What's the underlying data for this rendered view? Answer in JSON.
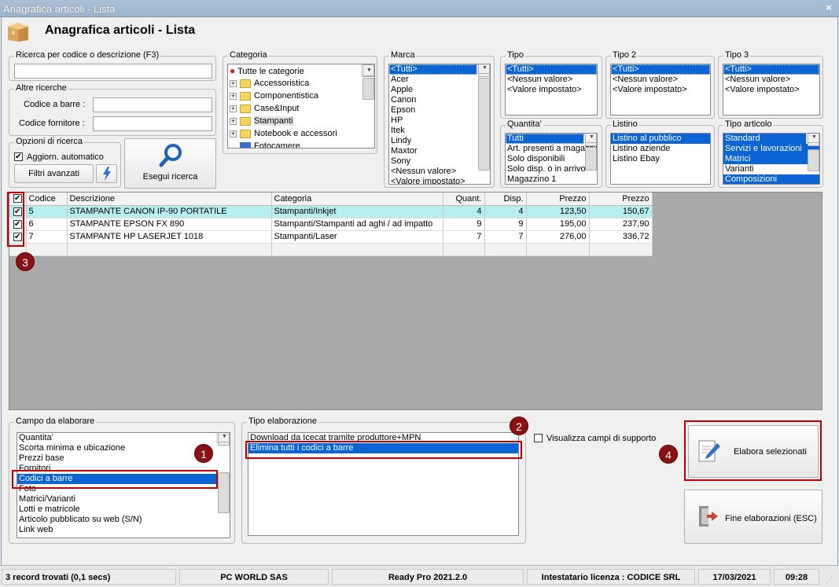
{
  "window": {
    "title": "Anagrafica articoli  - Lista",
    "close": "×"
  },
  "page_title": "Anagrafica articoli  - Lista",
  "search": {
    "label": "Ricerca per codice o descrizione (F3)",
    "value": ""
  },
  "altre": {
    "label": "Altre ricerche",
    "barcode_label": "Codice a barre :",
    "supplier_label": "Codice fornitore :"
  },
  "opzioni": {
    "label": "Opzioni di ricerca",
    "auto_label": "Aggiorn. automatico",
    "filtri": "Filtri avanzati",
    "esegui": "Esegui ricerca"
  },
  "categoria": {
    "label": "Categoria",
    "items": [
      "Tutte le categorie",
      "Accessoristica",
      "Componentistica",
      "Case&Input",
      "Stampanti",
      "Notebook e accessori",
      "Fotocamere"
    ]
  },
  "marca": {
    "label": "Marca",
    "items": [
      "<Tutti>",
      "Acer",
      "Apple",
      "Canon",
      "Epson",
      "HP",
      "Itek",
      "Lindy",
      "Maxtor",
      "Sony",
      "<Nessun valore>",
      "<Valore impostato>"
    ]
  },
  "tipo": {
    "label": "Tipo",
    "items": [
      "<Tutti>",
      "<Nessun valore>",
      "<Valore impostato>"
    ]
  },
  "tipo2": {
    "label": "Tipo 2",
    "items": [
      "<Tutti>",
      "<Nessun valore>",
      "<Valore impostato>"
    ]
  },
  "tipo3": {
    "label": "Tipo 3",
    "items": [
      "<Tutti>",
      "<Nessun valore>",
      "<Valore impostato>"
    ]
  },
  "quantita": {
    "label": "Quantita'",
    "items": [
      "Tutti",
      "Art. presenti a magazzino",
      "Solo disponibili",
      "Solo disp. o in arrivo",
      "Magazzino 1"
    ]
  },
  "listino": {
    "label": "Listino",
    "items": [
      "Listino al pubblico",
      "Listino aziende",
      "Listino Ebay"
    ]
  },
  "tipo_articolo": {
    "label": "Tipo articolo",
    "items": [
      "Standard",
      "Servizi e lavorazioni",
      "Matrici",
      "Varianti",
      "Composizioni"
    ]
  },
  "grid": {
    "headers": [
      "Codice",
      "Descrizione",
      "Categoria",
      "Quant.",
      "Disp.",
      "Prezzo",
      "Prezzo"
    ],
    "rows": [
      [
        "5",
        "STAMPANTE CANON IP-90 PORTATILE",
        "Stampanti/Inkjet",
        "4",
        "4",
        "123,50",
        "150,67"
      ],
      [
        "6",
        "STAMPANTE EPSON FX 890",
        "Stampanti/Stampanti ad aghi / ad impatto",
        "9",
        "9",
        "195,00",
        "237,90"
      ],
      [
        "7",
        "STAMPANTE HP LASERJET 1018",
        "Stampanti/Laser",
        "7",
        "7",
        "276,00",
        "336,72"
      ]
    ]
  },
  "campo": {
    "label": "Campo da elaborare",
    "items": [
      "Quantita'",
      "Scorta minima e ubicazione",
      "Prezzi base",
      "Fornitori",
      "Codici a barre",
      "Foto",
      "Matrici/Varianti",
      "Lotti e matricole",
      "Articolo pubblicato su web (S/N)",
      "Link web"
    ]
  },
  "tipo_elab": {
    "label": "Tipo elaborazione",
    "items": [
      "Download da Icecat tramite produttore+MPN",
      "Elimina tutti i codici a barre"
    ]
  },
  "visualizza": "Visualizza campi di supporto",
  "elabora": "Elabora selezionati",
  "fine": "Fine elaborazioni (ESC)",
  "badges": [
    "1",
    "2",
    "3",
    "4"
  ],
  "status": {
    "records": "3 record trovati (0,1 secs)",
    "company": "PC WORLD SAS",
    "version": "Ready Pro 2021.2.0",
    "license": "Intestatario licenza : CODICE SRL",
    "date": "17/03/2021",
    "time": "09:28"
  },
  "colors": {
    "selection": "#0a64d4",
    "highlight_row": "#b9eef0",
    "annotation": "#c00000",
    "badge": "#8b1014"
  }
}
